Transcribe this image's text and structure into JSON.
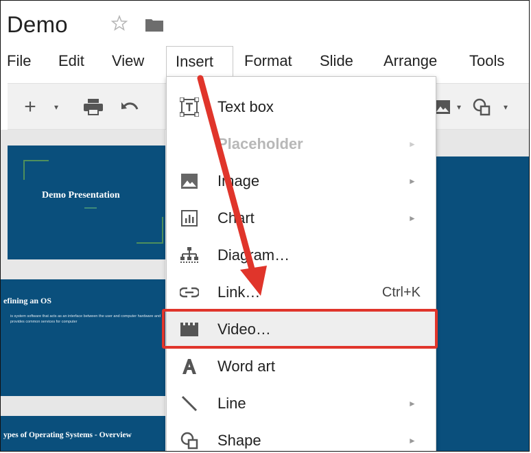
{
  "document": {
    "title": "Demo"
  },
  "menubar": {
    "items": [
      {
        "label": "File"
      },
      {
        "label": "Edit"
      },
      {
        "label": "View"
      },
      {
        "label": "Insert"
      },
      {
        "label": "Format"
      },
      {
        "label": "Slide"
      },
      {
        "label": "Arrange"
      },
      {
        "label": "Tools"
      }
    ]
  },
  "toolbar": {
    "icons": [
      "plus-icon",
      "dropdown-caret-icon",
      "print-icon",
      "undo-icon",
      "image-icon",
      "shape-icon"
    ]
  },
  "slides": [
    {
      "title": "Demo Presentation"
    },
    {
      "title": "efining an OS",
      "body": "is system software that acts as an interface between the user and computer hardware and provides common services for computer"
    },
    {
      "title": "ypes of Operating Systems - Overview"
    }
  ],
  "insert_menu": {
    "items": [
      {
        "label": "Text box",
        "icon": "text-box-icon",
        "submenu": false
      },
      {
        "label": "Placeholder",
        "icon": "",
        "submenu": true,
        "disabled": true
      },
      {
        "label": "Image",
        "icon": "image-icon",
        "submenu": true
      },
      {
        "label": "Chart",
        "icon": "chart-icon",
        "submenu": true
      },
      {
        "label": "Diagram…",
        "icon": "diagram-icon",
        "submenu": false
      },
      {
        "label": "Link…",
        "icon": "link-icon",
        "submenu": false,
        "shortcut": "Ctrl+K"
      },
      {
        "label": "Video…",
        "icon": "video-icon",
        "submenu": false,
        "highlighted": true
      },
      {
        "label": "Word art",
        "icon": "word-art-icon",
        "submenu": false
      },
      {
        "label": "Line",
        "icon": "line-icon",
        "submenu": true
      },
      {
        "label": "Shape",
        "icon": "shape-icon",
        "submenu": true
      }
    ]
  },
  "colors": {
    "slide_bg": "#0a4f7c",
    "annotation_red": "#e0352b",
    "highlight_row": "#eeeeee"
  }
}
